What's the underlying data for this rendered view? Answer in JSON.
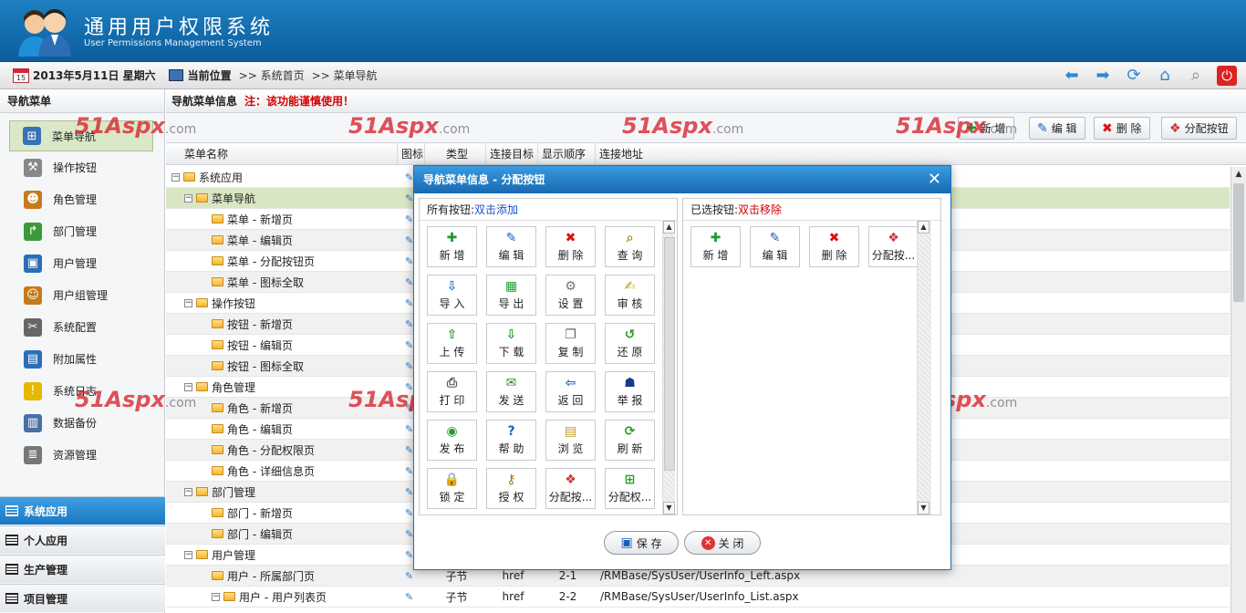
{
  "app": {
    "title": "通用用户权限系统",
    "subtitle": "User Permissions Management System"
  },
  "topbar": {
    "date": "2013年5月11日 星期六",
    "cal_day": "15",
    "location_label": "当前位置",
    "crumb1": ">> 系统首页",
    "crumb2": ">> 菜单导航"
  },
  "left": {
    "header": "导航菜单",
    "items": [
      {
        "label": "菜单导航",
        "icon": "sitemap-icon"
      },
      {
        "label": "操作按钮",
        "icon": "wrench-icon"
      },
      {
        "label": "角色管理",
        "icon": "users-icon"
      },
      {
        "label": "部门管理",
        "icon": "arrow-branch-icon"
      },
      {
        "label": "用户管理",
        "icon": "user-card-icon"
      },
      {
        "label": "用户组管理",
        "icon": "user-group-icon"
      },
      {
        "label": "系统配置",
        "icon": "tools-icon"
      },
      {
        "label": "附加属性",
        "icon": "book-icon"
      },
      {
        "label": "系统日志",
        "icon": "warning-icon"
      },
      {
        "label": "数据备份",
        "icon": "backup-icon"
      },
      {
        "label": "资源管理",
        "icon": "database-icon"
      }
    ],
    "sections": [
      "系统应用",
      "个人应用",
      "生产管理",
      "项目管理"
    ]
  },
  "main": {
    "header": "导航菜单信息",
    "warning": "注：该功能谨慎使用！",
    "toolbar": {
      "add": "新 增",
      "edit": "编 辑",
      "delete": "删 除",
      "assign": "分配按钮"
    },
    "columns": [
      "菜单名称",
      "图标",
      "类型",
      "连接目标",
      "显示顺序",
      "连接地址"
    ],
    "rows": [
      {
        "name": "系统应用",
        "level": 0,
        "toggle": "-"
      },
      {
        "name": "菜单导航",
        "level": 1,
        "toggle": "-"
      },
      {
        "name": "菜单 - 新增页",
        "level": 2
      },
      {
        "name": "菜单 - 编辑页",
        "level": 2
      },
      {
        "name": "菜单 - 分配按钮页",
        "level": 2
      },
      {
        "name": "菜单 - 图标全取",
        "level": 2
      },
      {
        "name": "操作按钮",
        "level": 1,
        "toggle": "-"
      },
      {
        "name": "按钮 - 新增页",
        "level": 2
      },
      {
        "name": "按钮 - 编辑页",
        "level": 2
      },
      {
        "name": "按钮 - 图标全取",
        "level": 2
      },
      {
        "name": "角色管理",
        "level": 1,
        "toggle": "-"
      },
      {
        "name": "角色 - 新增页",
        "level": 2
      },
      {
        "name": "角色 - 编辑页",
        "level": 2
      },
      {
        "name": "角色 - 分配权限页",
        "level": 2
      },
      {
        "name": "角色 - 详细信息页",
        "level": 2
      },
      {
        "name": "部门管理",
        "level": 1,
        "toggle": "-"
      },
      {
        "name": "部门 - 新增页",
        "level": 2
      },
      {
        "name": "部门 - 编辑页",
        "level": 2
      },
      {
        "name": "用户管理",
        "level": 1,
        "toggle": "-"
      },
      {
        "name": "用户 - 所属部门页",
        "level": 2,
        "type": "子节",
        "target": "href",
        "order": "2-1",
        "url": "/RMBase/SysUser/UserInfo_Left.aspx"
      },
      {
        "name": "用户 - 用户列表页",
        "level": 2,
        "toggle": "-",
        "type": "子节",
        "target": "href",
        "order": "2-2",
        "url": "/RMBase/SysUser/UserInfo_List.aspx"
      }
    ]
  },
  "dialog": {
    "title": "导航菜单信息 - 分配按钮",
    "all_label": "所有按钮:",
    "all_hint": "双击添加",
    "sel_label": "已选按钮:",
    "sel_hint": "双击移除",
    "all_buttons": [
      {
        "label": "新 增",
        "icon": "plus-icon",
        "glyph": "✚",
        "color": "#1a9a2a"
      },
      {
        "label": "编 辑",
        "icon": "pencil-icon",
        "glyph": "✎",
        "color": "#1d5fbf"
      },
      {
        "label": "删 除",
        "icon": "delete-icon",
        "glyph": "✖",
        "color": "#d11"
      },
      {
        "label": "查 询",
        "icon": "magnifier-icon",
        "glyph": "⌕",
        "color": "#b88a20"
      },
      {
        "label": "导 入",
        "icon": "import-icon",
        "glyph": "⇩",
        "color": "#2a7fd4"
      },
      {
        "label": "导 出",
        "icon": "export-icon",
        "glyph": "▦",
        "color": "#2a9a3a"
      },
      {
        "label": "设 置",
        "icon": "gear-icon",
        "glyph": "⚙",
        "color": "#777"
      },
      {
        "label": "审 核",
        "icon": "approve-icon",
        "glyph": "✍",
        "color": "#c49a1a"
      },
      {
        "label": "上 传",
        "icon": "upload-icon",
        "glyph": "⇧",
        "color": "#2a9a2a"
      },
      {
        "label": "下 载",
        "icon": "download-icon",
        "glyph": "⇩",
        "color": "#2a9a2a"
      },
      {
        "label": "复 制",
        "icon": "copy-icon",
        "glyph": "❐",
        "color": "#666"
      },
      {
        "label": "还 原",
        "icon": "restore-icon",
        "glyph": "↺",
        "color": "#2a9a2a"
      },
      {
        "label": "打 印",
        "icon": "printer-icon",
        "glyph": "⎙",
        "color": "#555"
      },
      {
        "label": "发 送",
        "icon": "send-icon",
        "glyph": "✉",
        "color": "#2a8a2a"
      },
      {
        "label": "返 回",
        "icon": "back-icon",
        "glyph": "⇦",
        "color": "#1d5fbf"
      },
      {
        "label": "举 报",
        "icon": "report-icon",
        "glyph": "☗",
        "color": "#1a3a8a"
      },
      {
        "label": "发 布",
        "icon": "publish-icon",
        "glyph": "◉",
        "color": "#2a9a2a"
      },
      {
        "label": "帮 助",
        "icon": "help-icon",
        "glyph": "?",
        "color": "#1d5fbf"
      },
      {
        "label": "浏 览",
        "icon": "browse-icon",
        "glyph": "▤",
        "color": "#c49a1a"
      },
      {
        "label": "刷 新",
        "icon": "refresh-icon",
        "glyph": "⟳",
        "color": "#2a9a2a"
      },
      {
        "label": "锁 定",
        "icon": "lock-icon",
        "glyph": "🔒",
        "color": "#c49a1a"
      },
      {
        "label": "授 权",
        "icon": "key-icon",
        "glyph": "⚷",
        "color": "#b0701a"
      },
      {
        "label": "分配按...",
        "icon": "assign-button-icon",
        "glyph": "❖",
        "color": "#c33"
      },
      {
        "label": "分配权...",
        "icon": "assign-permission-icon",
        "glyph": "⊞",
        "color": "#2a9a2a"
      }
    ],
    "selected_buttons": [
      {
        "label": "新 增",
        "icon": "plus-icon",
        "glyph": "✚",
        "color": "#1a9a2a"
      },
      {
        "label": "编 辑",
        "icon": "pencil-icon",
        "glyph": "✎",
        "color": "#1d5fbf"
      },
      {
        "label": "删 除",
        "icon": "delete-icon",
        "glyph": "✖",
        "color": "#d11"
      },
      {
        "label": "分配按...",
        "icon": "assign-button-icon",
        "glyph": "❖",
        "color": "#c33"
      }
    ],
    "save": "保 存",
    "close": "关 闭"
  },
  "watermark": {
    "brand": "51Aspx",
    "suffix": ".com"
  }
}
